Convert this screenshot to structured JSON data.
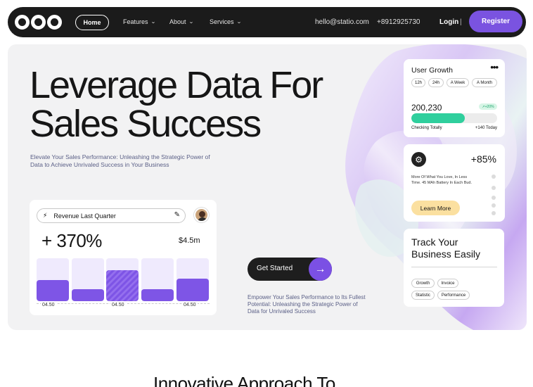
{
  "nav": {
    "home": "Home",
    "items": [
      {
        "label": "Features",
        "icon": "chevron-down-icon"
      },
      {
        "label": "About",
        "icon": "chevron-down-icon"
      },
      {
        "label": "Services",
        "icon": "chevron-down-icon"
      }
    ],
    "email": "hello@statio.com",
    "phone": "+8912925730",
    "login": "Login",
    "separator": "|",
    "register": "Register"
  },
  "hero": {
    "headline_line1": "Leverage Data For",
    "headline_line2": "Sales Success",
    "subhead": "Elevate Your Sales Performance: Unleashing the Strategic Power of Data to Achieve Unrivaled Success in Your Business",
    "cta_label": "Get Started",
    "cta_text": "Empower Your Sales Performance to Its Fullest Potential: Unleashing the Strategic Power of Data for Unrivaled Success"
  },
  "revenue_card": {
    "label": "Revenue Last Quarter",
    "percent": "+ 370%",
    "amount": "$4.5m",
    "bars": [
      0.5,
      0.28,
      0.72,
      0.28,
      0.53
    ],
    "hatched_index": 2,
    "axis_labels": [
      "04.50",
      "04.50",
      "04.50"
    ]
  },
  "user_growth": {
    "title": "User Growth",
    "menu": "•••",
    "filters": [
      "12h",
      "24h",
      "A Week",
      "A Month"
    ],
    "value": "200,230",
    "badge": "+20%",
    "progress": 0.62,
    "left_label": "Checking Totally",
    "right_label": "+140 Today"
  },
  "promo_card": {
    "value": "+85%",
    "text": "More Of What You Love, In Less Time. 45 MAh Battery In Each Bud.",
    "button": "Learn More"
  },
  "track_card": {
    "title_line1": "Track Your",
    "title_line2": "Business Easily",
    "tags": [
      "Growth",
      "Invoice",
      "Statistic",
      "Performance"
    ]
  },
  "section": {
    "title": "Innovative Approach To"
  },
  "colors": {
    "accent": "#7a53e0",
    "nav_bg": "#1b1b1b",
    "progress": "#2fcf9d",
    "learn_more": "#fbe0a0"
  }
}
